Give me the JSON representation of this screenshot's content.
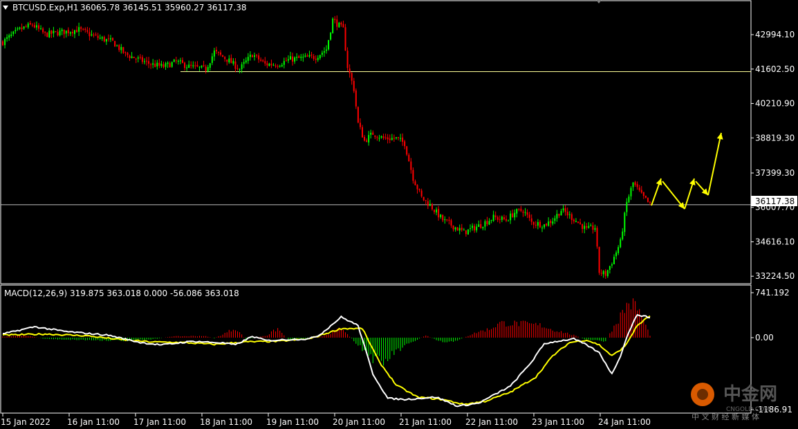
{
  "header": {
    "symbol": "BTCUSD.Exp,H1",
    "ohlc": "36065.78 36145.51 35960.27 36117.38"
  },
  "macd_header": "MACD(12,26,9) 319.875 363.018 0.000 -56.086 363.018",
  "current_price_label": "36117.38",
  "watermark": {
    "brand": "中金网",
    "sub": "CNGOLD.COM",
    "tagline": "中 文 财 经 新 媒 体"
  },
  "colors": {
    "background": "#000000",
    "bull": "#00ff00",
    "bear": "#ff0000",
    "frame": "#ffffff",
    "resistance": "#ffff99",
    "current": "#c0c0c0",
    "arrow": "#ffff00",
    "macd": "#ffffff",
    "signal": "#ffff00"
  },
  "chart_data": [
    {
      "type": "candlestick",
      "title": "BTCUSD.Exp,H1",
      "x_tick_labels": [
        "15 Jan 2022",
        "16 Jan 11:00",
        "17 Jan 11:00",
        "18 Jan 11:00",
        "19 Jan 11:00",
        "20 Jan 11:00",
        "21 Jan 11:00",
        "22 Jan 11:00",
        "23 Jan 11:00",
        "24 Jan 11:00"
      ],
      "y_tick_values": [
        42994.1,
        41602.5,
        40210.9,
        38819.3,
        37399.3,
        36007.7,
        34616.1,
        33224.5
      ],
      "y_tick_labels": [
        "42994.10",
        "41602.50",
        "40210.90",
        "38819.30",
        "37399.30",
        "36007.70",
        "34616.10",
        "33224.50"
      ],
      "ylim": [
        32950,
        44340
      ],
      "horizontal_line": 41500,
      "current_price": 36117.38,
      "path_keypoints": [
        [
          0,
          42700
        ],
        [
          8,
          43200
        ],
        [
          14,
          43400
        ],
        [
          20,
          43000
        ],
        [
          28,
          43100
        ],
        [
          36,
          43200
        ],
        [
          44,
          42900
        ],
        [
          52,
          42700
        ],
        [
          58,
          42200
        ],
        [
          64,
          42000
        ],
        [
          70,
          41800
        ],
        [
          76,
          41700
        ],
        [
          82,
          41900
        ],
        [
          88,
          41700
        ],
        [
          96,
          41600
        ],
        [
          100,
          42300
        ],
        [
          106,
          42000
        ],
        [
          112,
          41600
        ],
        [
          118,
          42200
        ],
        [
          124,
          41800
        ],
        [
          130,
          41800
        ],
        [
          136,
          42000
        ],
        [
          148,
          42100
        ],
        [
          153,
          42400
        ],
        [
          156,
          43600
        ],
        [
          161,
          43200
        ],
        [
          163,
          41700
        ],
        [
          166,
          40800
        ],
        [
          168,
          39400
        ],
        [
          171,
          38700
        ],
        [
          175,
          39000
        ],
        [
          180,
          38800
        ],
        [
          186,
          38800
        ],
        [
          190,
          38600
        ],
        [
          194,
          37200
        ],
        [
          198,
          36400
        ],
        [
          202,
          36100
        ],
        [
          208,
          35500
        ],
        [
          214,
          35200
        ],
        [
          218,
          35000
        ],
        [
          226,
          35300
        ],
        [
          232,
          35600
        ],
        [
          238,
          35500
        ],
        [
          242,
          35800
        ],
        [
          246,
          35900
        ],
        [
          250,
          35400
        ],
        [
          256,
          35300
        ],
        [
          260,
          35500
        ],
        [
          264,
          35900
        ],
        [
          266,
          35800
        ],
        [
          272,
          35400
        ],
        [
          276,
          35100
        ],
        [
          280,
          35200
        ],
        [
          282,
          33400
        ],
        [
          285,
          33300
        ],
        [
          288,
          33800
        ],
        [
          292,
          34600
        ],
        [
          295,
          36200
        ],
        [
          298,
          37000
        ],
        [
          302,
          36500
        ],
        [
          306,
          36117
        ]
      ],
      "forecast_arrows": [
        [
          [
            942,
            297
          ],
          [
            956,
            258
          ]
        ],
        [
          [
            958,
            262
          ],
          [
            990,
            302
          ]
        ],
        [
          [
            990,
            302
          ],
          [
            1004,
            258
          ]
        ],
        [
          [
            1006,
            262
          ],
          [
            1024,
            282
          ]
        ],
        [
          [
            1024,
            282
          ],
          [
            1043,
            192
          ]
        ]
      ]
    },
    {
      "type": "macd",
      "title": "MACD(12,26,9)",
      "params": [
        12,
        26,
        9
      ],
      "values": {
        "macd": 319.875,
        "signal": 363.018,
        "hist_a": 0.0,
        "hist_b": -56.086,
        "hist_c": 363.018
      },
      "y_tick_labels": [
        "741.192",
        "0.00",
        "-1186.91"
      ],
      "ylim": [
        -1186.91,
        741.192
      ],
      "macd_keypoints": [
        [
          0,
          60
        ],
        [
          15,
          180
        ],
        [
          30,
          100
        ],
        [
          50,
          40
        ],
        [
          65,
          -80
        ],
        [
          75,
          -120
        ],
        [
          90,
          -60
        ],
        [
          105,
          -90
        ],
        [
          110,
          -120
        ],
        [
          118,
          20
        ],
        [
          125,
          -50
        ],
        [
          135,
          -30
        ],
        [
          145,
          -20
        ],
        [
          150,
          50
        ],
        [
          160,
          340
        ],
        [
          168,
          200
        ],
        [
          175,
          -600
        ],
        [
          182,
          -1000
        ],
        [
          190,
          -1020
        ],
        [
          205,
          -980
        ],
        [
          215,
          -1130
        ],
        [
          225,
          -1080
        ],
        [
          240,
          -800
        ],
        [
          250,
          -400
        ],
        [
          256,
          -100
        ],
        [
          262,
          -60
        ],
        [
          270,
          -20
        ],
        [
          276,
          -120
        ],
        [
          282,
          -250
        ],
        [
          288,
          -600
        ],
        [
          292,
          -300
        ],
        [
          296,
          100
        ],
        [
          300,
          380
        ],
        [
          306,
          330
        ]
      ],
      "signal_keypoints": [
        [
          0,
          40
        ],
        [
          20,
          60
        ],
        [
          40,
          30
        ],
        [
          55,
          -30
        ],
        [
          70,
          -70
        ],
        [
          85,
          -80
        ],
        [
          100,
          -110
        ],
        [
          115,
          -70
        ],
        [
          130,
          -60
        ],
        [
          145,
          -20
        ],
        [
          160,
          150
        ],
        [
          170,
          150
        ],
        [
          178,
          -400
        ],
        [
          186,
          -780
        ],
        [
          196,
          -980
        ],
        [
          208,
          -1020
        ],
        [
          218,
          -1100
        ],
        [
          228,
          -1050
        ],
        [
          240,
          -900
        ],
        [
          252,
          -650
        ],
        [
          260,
          -300
        ],
        [
          268,
          -80
        ],
        [
          276,
          -40
        ],
        [
          282,
          -120
        ],
        [
          288,
          -300
        ],
        [
          294,
          -150
        ],
        [
          300,
          200
        ],
        [
          306,
          363
        ]
      ],
      "hist_keypoints": [
        [
          0,
          20
        ],
        [
          10,
          40
        ],
        [
          20,
          -20
        ],
        [
          40,
          -40
        ],
        [
          60,
          -50
        ],
        [
          70,
          -30
        ],
        [
          80,
          20
        ],
        [
          95,
          30
        ],
        [
          100,
          -10
        ],
        [
          105,
          70
        ],
        [
          110,
          160
        ],
        [
          115,
          -30
        ],
        [
          125,
          40
        ],
        [
          130,
          150
        ],
        [
          135,
          -40
        ],
        [
          150,
          10
        ],
        [
          160,
          150
        ],
        [
          170,
          -180
        ],
        [
          175,
          -340
        ],
        [
          180,
          -420
        ],
        [
          185,
          -250
        ],
        [
          190,
          -150
        ],
        [
          195,
          -50
        ],
        [
          200,
          40
        ],
        [
          205,
          -40
        ],
        [
          210,
          -90
        ],
        [
          215,
          -40
        ],
        [
          220,
          30
        ],
        [
          225,
          100
        ],
        [
          230,
          140
        ],
        [
          235,
          240
        ],
        [
          245,
          230
        ],
        [
          255,
          200
        ],
        [
          260,
          130
        ],
        [
          265,
          90
        ],
        [
          270,
          40
        ],
        [
          275,
          -30
        ],
        [
          285,
          -60
        ],
        [
          290,
          250
        ],
        [
          296,
          580
        ],
        [
          300,
          500
        ],
        [
          306,
          40
        ]
      ]
    }
  ]
}
